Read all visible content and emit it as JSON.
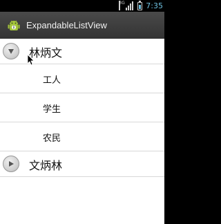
{
  "status_bar": {
    "network": "3G",
    "time": "7:35"
  },
  "app": {
    "title": "ExpandableListView"
  },
  "groups": [
    {
      "label": "林炳文",
      "expanded": true,
      "children": [
        "工人",
        "学生",
        "农民"
      ]
    },
    {
      "label": "文炳林",
      "expanded": false
    }
  ]
}
